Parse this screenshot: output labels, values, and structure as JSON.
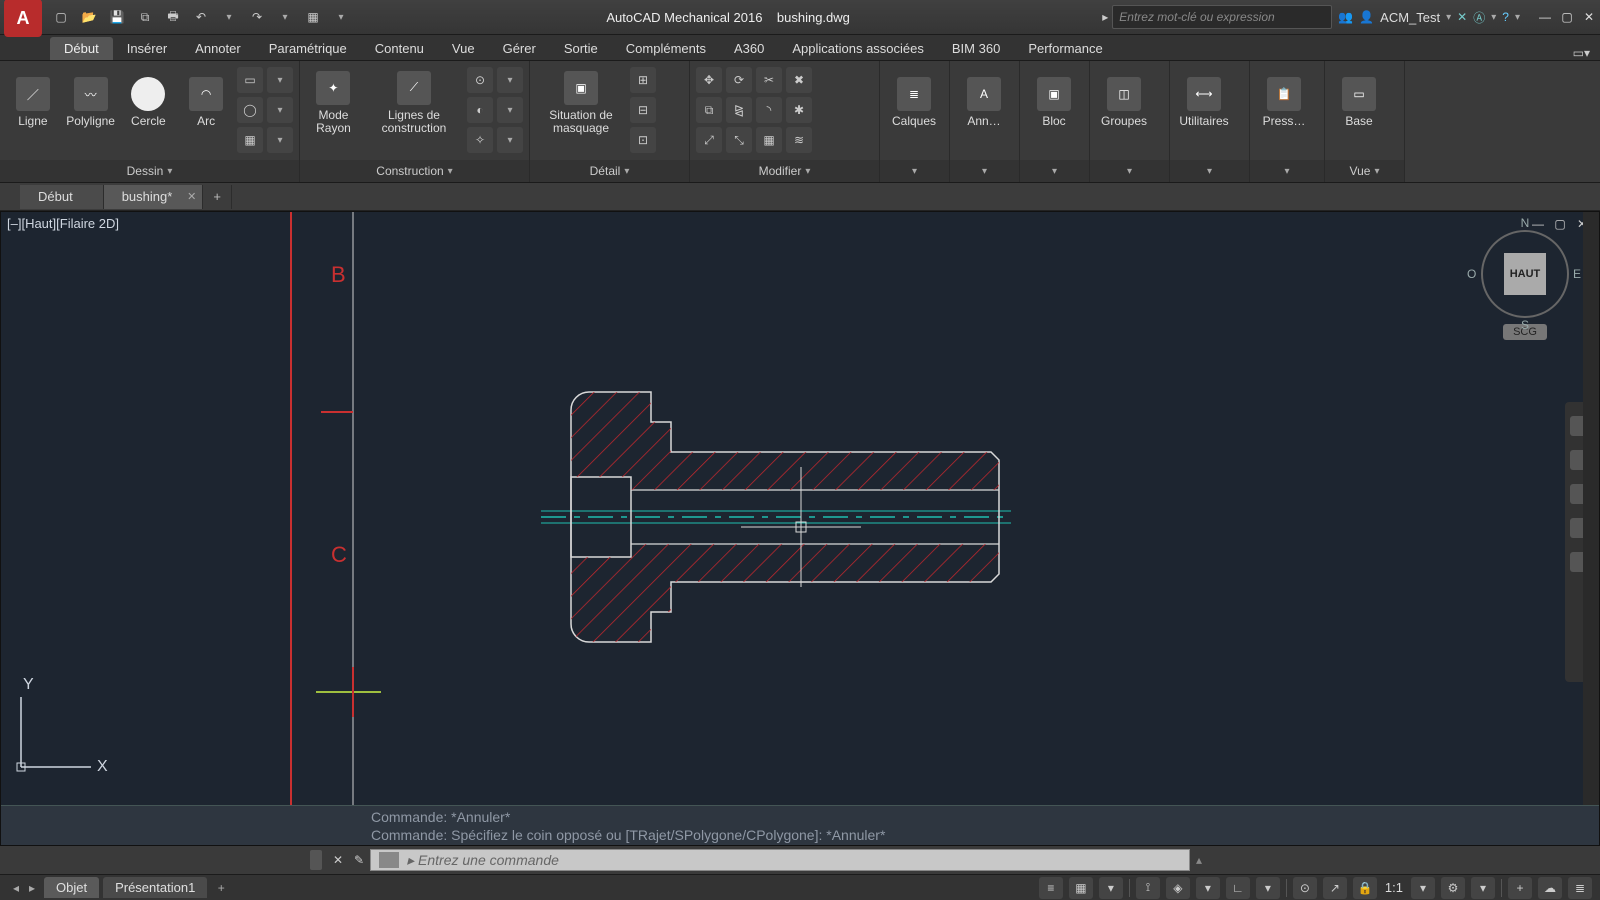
{
  "app": {
    "title": "AutoCAD Mechanical 2016",
    "document": "bushing.dwg",
    "search_placeholder": "Entrez mot-clé ou expression",
    "user": "ACM_Test"
  },
  "menu": {
    "tabs": [
      "Début",
      "Insérer",
      "Annoter",
      "Paramétrique",
      "Contenu",
      "Vue",
      "Gérer",
      "Sortie",
      "Compléments",
      "A360",
      "Applications associées",
      "BIM 360",
      "Performance"
    ],
    "active_index": 0
  },
  "ribbon": {
    "panels": [
      {
        "title": "Dessin",
        "big": [
          {
            "label": "Ligne",
            "icon": "line-icon"
          },
          {
            "label": "Polyligne",
            "icon": "polyline-icon"
          },
          {
            "label": "Cercle",
            "icon": "circle-icon"
          },
          {
            "label": "Arc",
            "icon": "arc-icon"
          }
        ]
      },
      {
        "title": "Construction",
        "big": [
          {
            "label": "Mode Rayon",
            "icon": "mode-rayon-icon"
          },
          {
            "label": "Lignes de construction",
            "icon": "construction-lines-icon"
          }
        ]
      },
      {
        "title": "Détail",
        "big": [
          {
            "label": "Situation de masquage",
            "icon": "mask-situation-icon"
          }
        ]
      },
      {
        "title": "Modifier",
        "big": []
      },
      {
        "title": "Calques",
        "big": [
          {
            "label": "Calques",
            "icon": "layers-icon"
          }
        ]
      },
      {
        "title": "Ann…",
        "big": [
          {
            "label": "Ann…",
            "icon": "annotation-icon"
          }
        ]
      },
      {
        "title": "Bloc",
        "big": [
          {
            "label": "Bloc",
            "icon": "block-icon"
          }
        ]
      },
      {
        "title": "Groupes",
        "big": [
          {
            "label": "Groupes",
            "icon": "groups-icon"
          }
        ]
      },
      {
        "title": "Utilitaires",
        "big": [
          {
            "label": "Utilitaires",
            "icon": "utilities-icon"
          }
        ]
      },
      {
        "title": "Press…",
        "big": [
          {
            "label": "Press…",
            "icon": "clipboard-icon"
          }
        ]
      },
      {
        "title": "Vue",
        "big": [
          {
            "label": "Base",
            "icon": "base-view-icon"
          }
        ]
      }
    ]
  },
  "file_tabs": {
    "items": [
      {
        "label": "Début",
        "dirty": false
      },
      {
        "label": "bushing*",
        "dirty": true
      }
    ],
    "active_index": 1
  },
  "viewport": {
    "label": "[–][Haut][Filaire 2D]",
    "viewcube_face": "HAUT",
    "viewcube_n": "N",
    "viewcube_s": "S",
    "viewcube_e": "E",
    "viewcube_o": "O",
    "scg": "SCG",
    "ucs_y": "Y",
    "ucs_x": "X",
    "markers": {
      "b": "B",
      "c": "C"
    }
  },
  "command": {
    "history1": "Commande: *Annuler*",
    "history2": "Commande: Spécifiez le coin opposé ou [TRajet/SPolygone/CPolygone]: *Annuler*",
    "placeholder": "Entrez une commande"
  },
  "bottom_tabs": {
    "items": [
      "Objet",
      "Présentation1"
    ],
    "active_index": 0
  },
  "status": {
    "scale": "1:1"
  },
  "colors": {
    "canvas": "#1d2530",
    "hatch": "#c1272d",
    "outline": "#d9d9d9",
    "centerline": "#1fbfb0",
    "axis_y": "#3fbf3f",
    "axis_x": "#c93030",
    "ruler": "#c93030"
  }
}
